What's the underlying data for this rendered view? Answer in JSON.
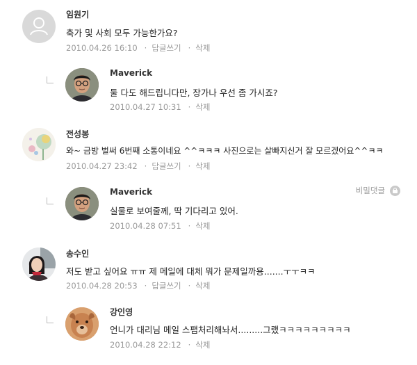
{
  "comments": [
    {
      "author": "임원기",
      "text": "축가 및 사회 모두 가능한가요?",
      "date": "2010.04.26 16:10",
      "reply_label": "답글쓰기",
      "delete_label": "삭제",
      "avatar": "default-profile"
    },
    {
      "author": "Maverick",
      "text": "둘 다도 해드립니다만, 장가나 우선 좀 가시죠?",
      "date": "2010.04.27 10:31",
      "delete_label": "삭제",
      "avatar": "man-glasses",
      "is_reply": true
    },
    {
      "author": "전성봉",
      "text": "와~ 금방 벌써 6번째 소통이네요 ^^ㅋㅋㅋ 사진으로는 살빠지신거 잘 모르겠어요^^ㅋㅋ",
      "date": "2010.04.27 23:42",
      "reply_label": "답글쓰기",
      "delete_label": "삭제",
      "avatar": "flower-illustration"
    },
    {
      "author": "Maverick",
      "text": "실물로 보여줄께, 딱 기다리고 있어.",
      "date": "2010.04.28 07:51",
      "delete_label": "삭제",
      "avatar": "man-glasses",
      "is_reply": true,
      "secret_label": "비밀댓글"
    },
    {
      "author": "송수인",
      "text": "저도 받고 싶어요 ㅠㅠ 제 메일에 대체 뭐가 문제일까용.......ㅜㅜㅋㅋ",
      "date": "2010.04.28 20:53",
      "reply_label": "답글쓰기",
      "delete_label": "삭제",
      "avatar": "woman-photo"
    },
    {
      "author": "강인영",
      "text": "언니가 대리님 메일 스팸처리해놔서.........그랬ㅋㅋㅋㅋㅋㅋㅋㅋㅋ",
      "date": "2010.04.28 22:12",
      "delete_label": "삭제",
      "avatar": "dog-photo",
      "is_reply": true
    }
  ],
  "colors": {
    "text": "#222222",
    "meta": "#999999",
    "author": "#333333"
  }
}
